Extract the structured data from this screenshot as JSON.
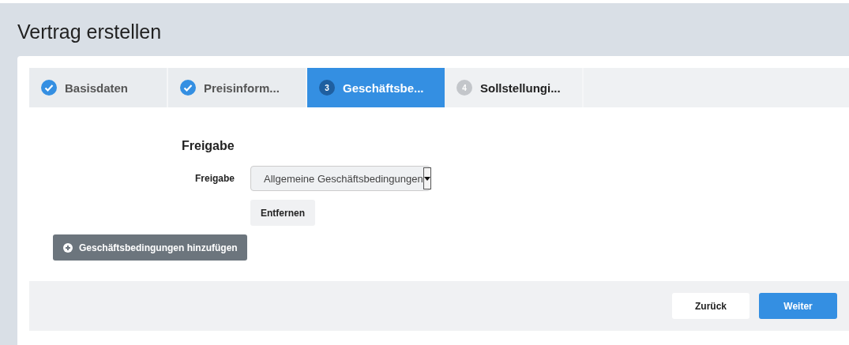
{
  "page": {
    "title": "Vertrag erstellen"
  },
  "steps": [
    {
      "kind": "done",
      "label": "Basisdaten",
      "selected": false
    },
    {
      "kind": "done",
      "label": "Preisinform...",
      "selected": false
    },
    {
      "kind": "current",
      "number": "3",
      "label": "Geschäftsbe...",
      "selected": true
    },
    {
      "kind": "pending",
      "number": "4",
      "label": "Sollstellungi...",
      "selected": false
    }
  ],
  "section": {
    "heading": "Freigabe",
    "field_label": "Freigabe",
    "select_value": "Allgemeine Geschäftsbedingungen",
    "remove_button": "Entfernen",
    "add_button": "Geschäftsbedingungen hinzufügen"
  },
  "footer": {
    "back_button": "Zurück",
    "next_button": "Weiter"
  }
}
